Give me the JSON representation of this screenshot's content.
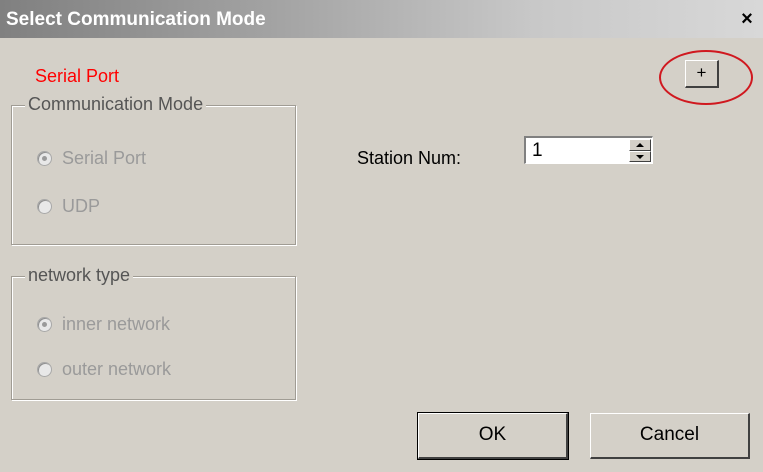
{
  "window": {
    "title": "Select Communication Mode",
    "close_label": "×"
  },
  "status": {
    "label": "Serial Port",
    "color": "#ff0000"
  },
  "toolbar": {
    "plus_label": "+"
  },
  "communication_mode": {
    "legend": "Communication Mode",
    "options": [
      {
        "label": "Serial Port",
        "checked": true
      },
      {
        "label": "UDP",
        "checked": false
      }
    ]
  },
  "network_type": {
    "legend": "network type",
    "options": [
      {
        "label": "inner network",
        "checked": true
      },
      {
        "label": "outer network",
        "checked": false
      }
    ]
  },
  "station": {
    "label": "Station Num:",
    "value": "1"
  },
  "buttons": {
    "ok": "OK",
    "cancel": "Cancel"
  },
  "highlight": {
    "color": "#d0181f"
  }
}
